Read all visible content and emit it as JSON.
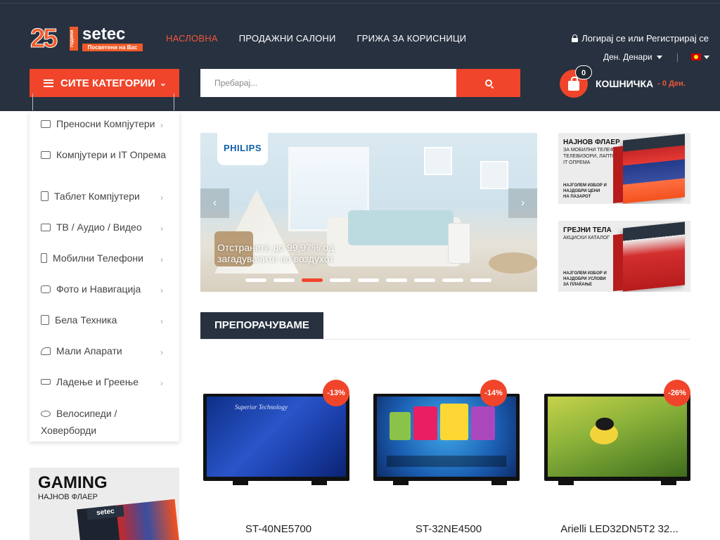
{
  "header": {
    "logo": {
      "number": "25",
      "years": "години",
      "brand": "setec",
      "tagline": "Посветени на Вас"
    },
    "nav": [
      "НАСЛОВНА",
      "ПРОДАЖНИ САЛОНИ",
      "ГРИЖА ЗА КОРИСНИЦИ"
    ],
    "nav_active_index": 0,
    "login_text": "Логирај се или Регистрирај се",
    "currency": "Ден. Денари",
    "language_flag": "macedonia-flag-icon",
    "categories_button": "СИТЕ КАТЕГОРИИ",
    "search_placeholder": "Пребарај...",
    "cart": {
      "count": "0",
      "label": "КОШНИЧКА",
      "total": "- 0 Ден."
    }
  },
  "categories": [
    {
      "label": "Преносни Компјутери",
      "icon": "laptop-icon"
    },
    {
      "label": "Компјутери и IT Опрема",
      "icon": "desktop-icon"
    },
    {
      "label": "Таблет Компјутери",
      "icon": "tablet-icon"
    },
    {
      "label": "ТВ / Аудио / Видео",
      "icon": "tv-icon"
    },
    {
      "label": "Мобилни Телефони",
      "icon": "phone-icon"
    },
    {
      "label": "Фото и Навигација",
      "icon": "camera-icon"
    },
    {
      "label": "Бела Техника",
      "icon": "washer-icon"
    },
    {
      "label": "Мали Апарати",
      "icon": "iron-icon"
    },
    {
      "label": "Ладење и Греење",
      "icon": "ac-icon"
    },
    {
      "label": "Велосипеди / Ховерборди",
      "icon": "bicycle-icon"
    }
  ],
  "slider": {
    "brand": "PHILIPS",
    "caption": "Отстранете до 99,97% од загадувачите во воздухот",
    "slide_count": 9,
    "active_slide": 2
  },
  "flyers": [
    {
      "title": "НАЈНОВ ФЛАЕР",
      "subtitle": "ЗА МОБИЛНИ ТЕЛЕФОНИ,\nТЕЛЕВИЗОРИ, ЛАПТОПИ И\nIT ОПРЕМА",
      "footer": "НАЈГОЛЕМ ИЗБОР И\nНАЈДОБРИ ЦЕНИ\nНА ПАЗАРОТ"
    },
    {
      "title": "ГРЕЈНИ ТЕЛА",
      "subtitle": "АКЦИСКИ КАТАЛОГ",
      "footer": "НАЈГОЛЕМ ИЗБОР И\nНАЈДОБРИ УСЛОВИ\nЗА ПЛАЌАЊЕ"
    }
  ],
  "section_title": "ПРЕПОРАЧУВАМЕ",
  "products": [
    {
      "name": "ST-40NE5700",
      "discount": "-13%",
      "screen_brand": "Superior Technology"
    },
    {
      "name": "ST-32NE4500",
      "discount": "-14%"
    },
    {
      "name": "Arielli LED32DN5T2 32...",
      "discount": "-26%"
    }
  ],
  "gaming_banner": {
    "title": "GAMING",
    "subtitle": "НАЈНОВ ФЛАЕР",
    "logo": "setec"
  },
  "colors": {
    "header_bg": "#273140",
    "accent": "#f0452b",
    "nav_active": "#f0563b"
  }
}
